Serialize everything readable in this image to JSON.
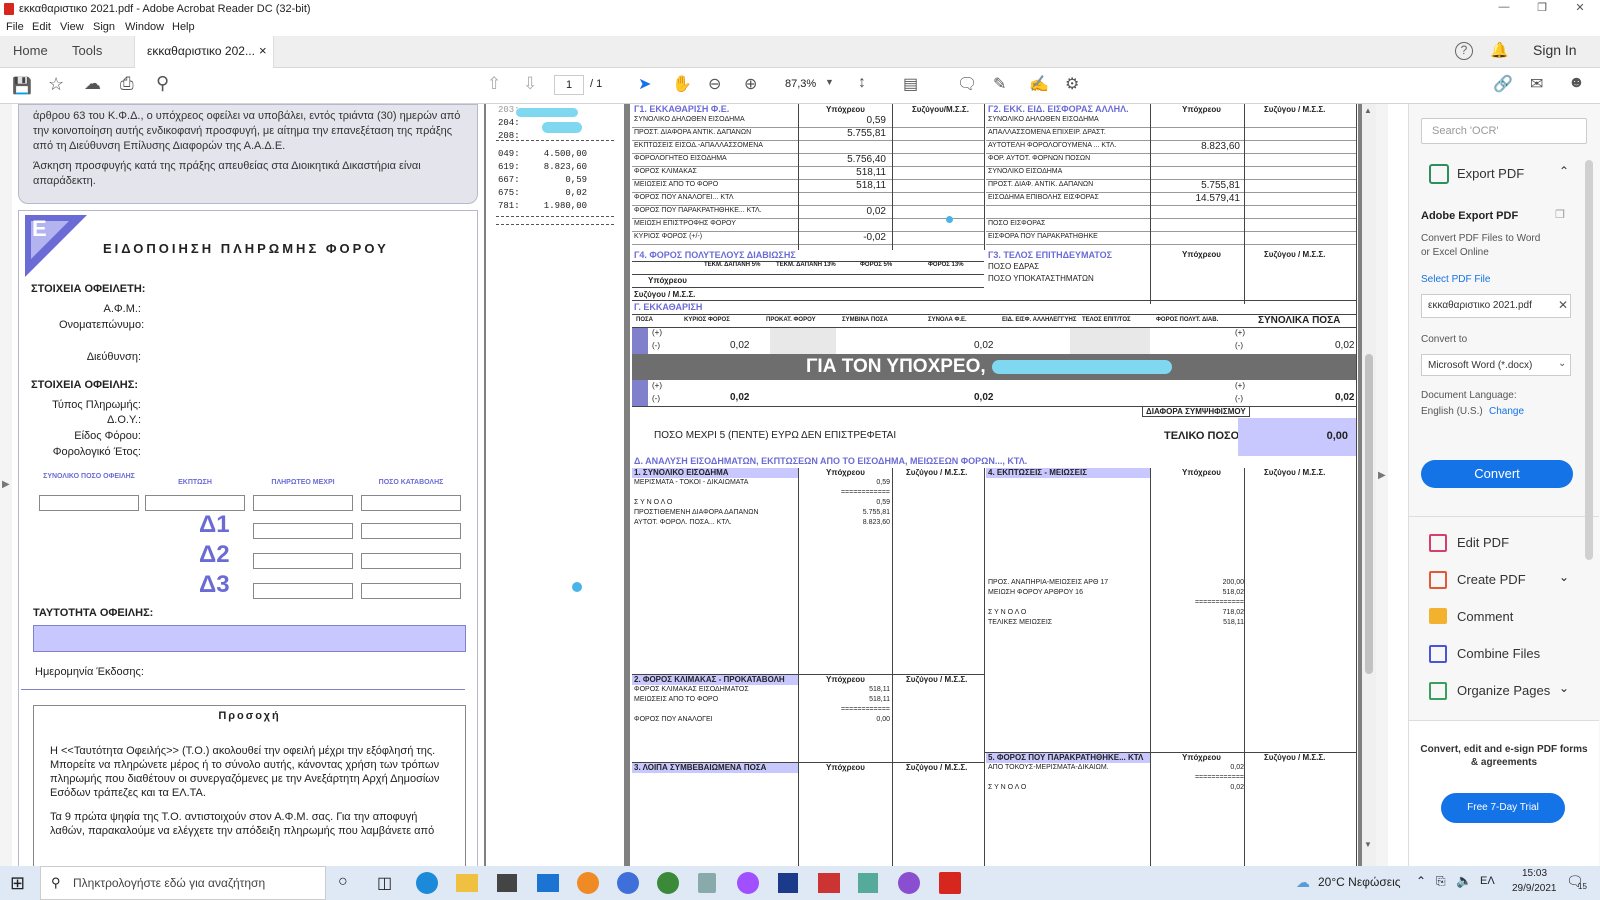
{
  "window": {
    "title": "εκκαθαριστικο 2021.pdf - Adobe Acrobat Reader DC (32-bit)"
  },
  "menu": [
    "File",
    "Edit",
    "View",
    "Sign",
    "Window",
    "Help"
  ],
  "tabs": {
    "home": "Home",
    "tools": "Tools",
    "doc": "εκκαθαριστικο 202...",
    "close": "×",
    "signin": "Sign In"
  },
  "toolbar": {
    "page_current": "1",
    "page_total": "/ 1",
    "zoom": "87,3%"
  },
  "left_page": {
    "appeal_text": "άρθρου 63 του Κ.Φ.Δ., ο υπόχρεος οφείλει να υποβάλει, εντός τριάντα (30) ημερών από την κοινοποίηση αυτής ενδικοφανή προσφυγή, με αίτημα την επανεξέταση της πράξης από τη Διεύθυνση Επίλυσης Διαφορών της Α.Α.Δ.Ε.",
    "appeal_text2": "Άσκηση προσφυγής κατά της πράξης απευθείας στα Διοικητικά Δικαστήρια είναι απαράδεκτη.",
    "badge": "E",
    "title": "ΕΙΔΟΠΟΙΗΣΗ ΠΛΗΡΩΜΗΣ ΦΟΡΟΥ",
    "debtor_header": "ΣΤΟΙΧΕΙΑ ΟΦΕΙΛΕΤΗ:",
    "afm": "Α.Φ.Μ.:",
    "name": "Ονοματεπώνυμο:",
    "address": "Διεύθυνση:",
    "debt_header": "ΣΤΟΙΧΕΙΑ ΟΦΕΙΛΗΣ:",
    "pay_type": "Τύπος Πληρωμής:",
    "doy": "Δ.Ο.Υ.:",
    "tax_kind": "Είδος Φόρου:",
    "tax_year": "Φορολογικό Έτος:",
    "cols": [
      "ΣΥΝΟΛΙΚΟ ΠΟΣΟ ΟΦΕΙΛΗΣ",
      "ΕΚΠΤΩΣΗ",
      "ΠΛΗΡΩΤΕΟ ΜΕΧΡΙ",
      "ΠΟΣΟ ΚΑΤΑΒΟΛΗΣ"
    ],
    "deltas": [
      "Δ1",
      "Δ2",
      "Δ3"
    ],
    "identity": "ΤΑΥΤΟΤΗΤΑ ΟΦΕΙΛΗΣ:",
    "issue_date": "Ημερομηνία Έκδοσης:",
    "attention": "Προσοχή",
    "attention_p1": "Η <<Ταυτότητα Οφειλής>> (Τ.Ο.) ακολουθεί την οφειλή μέχρι την εξόφλησή της. Μπορείτε να πληρώνετε μέρος ή το σύνολο αυτής, κάνοντας χρήση των τρόπων πληρωμής που διαθέτουν οι συνεργαζόμενες με την Ανεξάρτητη Αρχή Δημοσίων Εσόδων τράπεζες και τα ΕΛ.ΤΑ.",
    "attention_p2": "Τα 9 πρώτα ψηφία της Τ.Ο. αντιστοιχούν στον Α.Φ.Μ. σας. Για την αποφυγή λαθών, παρακαλούμε να ελέγχετε την απόδειξη πληρωμής που λαμβάνετε από"
  },
  "middle_page": {
    "codes": [
      {
        "code": "204:",
        "val": ""
      },
      {
        "code": "208:",
        "val": ""
      },
      {
        "code": "049:",
        "val": "4.500,00"
      },
      {
        "code": "619:",
        "val": "8.823,60"
      },
      {
        "code": "667:",
        "val": "0,59"
      },
      {
        "code": "675:",
        "val": "0,02"
      },
      {
        "code": "781:",
        "val": "1.980,00"
      }
    ],
    "top_code": "203: ..."
  },
  "right_page": {
    "g1_title": "Γ1. ΕΚΚΑΘΑΡΙΣΗ Φ.Ε.",
    "g2_title": "Γ2. ΕΚΚ. ΕΙΔ. ΕΙΣΦΟΡΑΣ ΑΛΛΗΛ.",
    "col_ypo": "Υπόχρεου",
    "col_syz": "Συζύγου/Μ.Σ.Σ.",
    "col_syz2": "Συζύγου / Μ.Σ.Σ.",
    "g1_rows": [
      {
        "label": "ΣΥΝΟΛΙΚΟ ΔΗΛΩΘΕΝ ΕΙΣΟΔΗΜΑ",
        "v": "0,59"
      },
      {
        "label": "ΠΡΟΣΤ. ΔΙΑΦΟΡΑ ΑΝΤΙΚ. ΔΑΠΑΝΩΝ",
        "v": "5.755,81"
      },
      {
        "label": "ΕΚΠΤΩΣΕΙΣ ΕΙΣΟΔ.-ΑΠΑΛΛΑΣΣΟΜΕΝΑ",
        "v": ""
      },
      {
        "label": "ΦΟΡΟΛΟΓΗΤΕΟ ΕΙΣΟΔΗΜΑ",
        "v": "5.756,40"
      },
      {
        "label": "ΦΟΡΟΣ ΚΛΙΜΑΚΑΣ",
        "v": "518,11"
      },
      {
        "label": "ΜΕΙΩΣΕΙΣ ΑΠΟ ΤΟ ΦΟΡΟ",
        "v": "518,11"
      },
      {
        "label": "ΦΟΡΟΣ ΠΟΥ ΑΝΑΛΟΓΕΙ... ΚΤΛ",
        "v": ""
      },
      {
        "label": "ΦΟΡΟΣ ΠΟΥ ΠΑΡΑΚΡΑΤΗΘΗΚΕ... ΚΤΛ.",
        "v": "0,02"
      },
      {
        "label": "ΜΕΙΩΣΗ ΕΠΙΣΤΡΟΦΗΣ ΦΟΡΟΥ",
        "v": ""
      },
      {
        "label": "ΚΥΡΙΟΣ ΦΟΡΟΣ (+/-)",
        "v": "-0,02"
      }
    ],
    "g2_rows": [
      {
        "label": "ΣΥΝΟΛΙΚΟ ΔΗΛΩΘΕΝ ΕΙΣΟΔΗΜΑ",
        "v": ""
      },
      {
        "label": "ΑΠΑΛΛΑΣΣΟΜΕΝΑ ΕΠΙΧΕΙΡ. ΔΡΑΣΤ.",
        "v": ""
      },
      {
        "label": "ΑΥΤΟΤΕΛΗ ΦΟΡΟΛΟΓΟΥΜΕΝΑ ... ΚΤΛ.",
        "v": "8.823,60"
      },
      {
        "label": "ΦΟΡ. ΑΥΤΟΤ. ΦΟΡΝΩΝ ΠΟΣΩΝ",
        "v": ""
      },
      {
        "label": "ΣΥΝΟΛΙΚΟ ΕΙΣΟΔΗΜΑ",
        "v": ""
      },
      {
        "label": "ΠΡΟΣΤ. ΔΙΑΦ. ΑΝΤΙΚ. ΔΑΠΑΝΩΝ",
        "v": "5.755,81"
      },
      {
        "label": "ΕΙΣΟΔΗΜΑ ΕΠΙΒΟΛΗΣ ΕΙΣΦΟΡΑΣ",
        "v": "14.579,41"
      },
      {
        "label": "",
        "v": ""
      },
      {
        "label": "ΠΟΣΟ ΕΙΣΦΟΡΑΣ",
        "v": ""
      },
      {
        "label": "ΕΙΣΦΟΡΑ ΠΟΥ ΠΑΡΑΚΡΑΤΗΘΗΚΕ",
        "v": ""
      }
    ],
    "g4_title": "Γ4. ΦΟΡΟΣ ΠΟΛΥΤΕΛΟΥΣ ΔΙΑΒΙΩΣΗΣ",
    "g4_cols": [
      "ΤΕΚΜ. ΔΑΠΑΝΗ 5%",
      "ΤΕΚΜ. ΔΑΠΑΝΗ 13%",
      "ΦΟΡΟΣ 5%",
      "ΦΟΡΟΣ 13%"
    ],
    "g3_title": "Γ3. ΤΕΛΟΣ ΕΠΙΤΗΔΕΥΜΑΤΟΣ",
    "g3_rows": [
      "ΠΟΣΟ ΕΔΡΑΣ",
      "ΠΟΣΟ ΥΠΟΚΑΤΑΣΤΗΜΑΤΩΝ"
    ],
    "g4_rows": [
      "Υπόχρεου",
      "Συζύγου / Μ.Σ.Σ."
    ],
    "g_title": "Γ. ΕΚΚΑΘΑΡΙΣΗ",
    "g_cols": [
      "ΠΟΣΑ",
      "ΚΥΡΙΟΣ ΦΟΡΟΣ",
      "ΠΡΟΚΑΤ. ΦΟΡΟΥ",
      "ΣΥΜΒΙΝΑ ΠΟΣΑ",
      "ΣΥΝΟΛΑ Φ.Ε.",
      "ΕΙΔ. ΕΙΣΦ. ΑΛΛΗΛΕΓΓΥΗΣ",
      "ΤΕΛΟΣ ΕΠΙΤ/ΤΟΣ",
      "ΦΟΡΟΣ ΠΟΛΥΤ. ΔΙΑΒ.",
      "ΣΥΝΟΛΙΚΑ ΠΟΣΑ"
    ],
    "g_side1": "ΥΠΟΧΡΕΟΥ",
    "g_side2": "ΣΥΝΟΛΑ",
    "plus": "(+)",
    "minus": "(-)",
    "g_val1": "0,02",
    "g_val2": "0,02",
    "g_val3": "0,02",
    "banner": "ΓΙΑ ΤΟΝ ΥΠΟΧΡΕΟ,",
    "diff_label": "ΔΙΑΦΟΡΑ ΣΥΜΨΗΦΙΣΜΟΥ",
    "five_euro": "ΠΟΣΟ ΜΕΧΡΙ 5 (ΠΕΝΤΕ) ΕΥΡΩ ΔΕΝ ΕΠΙΣΤΡΕΦΕΤΑΙ",
    "final_label": "ΤΕΛΙΚΟ ΠΟΣΟ",
    "final_value": "0,00",
    "d_title": "Δ. ΑΝΑΛΥΣΗ ΕΙΣΟΔΗΜΑΤΩΝ, ΕΚΠΤΩΣΕΩΝ ΑΠΟ ΤΟ ΕΙΣΟΔΗΜΑ, ΜΕΙΩΣΕΩΝ ΦΟΡΩΝ..., ΚΤΛ.",
    "d1_title": "1. ΣΥΝΟΛΙΚΟ ΕΙΣΟΔΗΜΑ",
    "d1_rows": [
      {
        "label": "ΜΕΡΙΣΜΑΤΑ - ΤΟΚΟΙ - ΔΙΚΑΙΩΜΑΤΑ",
        "v": "0,59"
      },
      {
        "label": "",
        "v": "============"
      },
      {
        "label": "Σ Υ Ν Ο Λ Ο",
        "v": "0,59"
      },
      {
        "label": "ΠΡΟΣΤΙΘΕΜΕΝΗ ΔΙΑΦΟΡΑ ΔΑΠΑΝΩΝ",
        "v": "5.755,81"
      },
      {
        "label": "ΑΥΤΟΤ. ΦΟΡΟΛ. ΠΟΣΑ... ΚΤΛ.",
        "v": "8.823,60"
      }
    ],
    "d4_title": "4. ΕΚΠΤΩΣΕΙΣ - ΜΕΙΩΣΕΙΣ",
    "d4_rows": [
      {
        "label": "ΠΡΟΣ. ΑΝΑΠΗΡΙΑ-ΜΕΙΩΣΕΙΣ ΑΡΘ 17",
        "v": "200,00"
      },
      {
        "label": "ΜΕΙΩΣΗ ΦΟΡΟΥ ΑΡΘΡΟΥ 16",
        "v": "518,02"
      },
      {
        "label": "",
        "v": "============"
      },
      {
        "label": "Σ Υ Ν Ο Λ Ο",
        "v": "718,02"
      },
      {
        "label": "ΤΕΛΙΚΕΣ ΜΕΙΩΣΕΙΣ",
        "v": "518,11"
      }
    ],
    "d2_title": "2. ΦΟΡΟΣ ΚΛΙΜΑΚΑΣ - ΠΡΟΚΑΤΑΒΟΛΗ",
    "d2_rows": [
      {
        "label": "ΦΟΡΟΣ ΚΛΙΜΑΚΑΣ ΕΙΣΟΔΗΜΑΤΟΣ",
        "v": "518,11"
      },
      {
        "label": "ΜΕΙΩΣΕΙΣ ΑΠΟ ΤΟ ΦΟΡΟ",
        "v": "518,11"
      },
      {
        "label": "",
        "v": "============"
      },
      {
        "label": "ΦΟΡΟΣ ΠΟΥ ΑΝΑΛΟΓΕΙ",
        "v": "0,00"
      }
    ],
    "d3_title": "3. ΛΟΙΠΑ ΣΥΜΒΕΒΑΙΩΜΕΝΑ ΠΟΣΑ",
    "d5_title": "5. ΦΟΡΟΣ ΠΟΥ ΠΑΡΑΚΡΑΤΗΘΗΚΕ... ΚΤΛ",
    "d5_rows": [
      {
        "label": "ΑΠΟ ΤΟΚΟΥΣ-ΜΕΡΙΣΜΑΤΑ-ΔΙΚΑΙΩΜ.",
        "v": "0,02"
      },
      {
        "label": "",
        "v": "============"
      },
      {
        "label": "Σ Υ Ν Ο Λ Ο",
        "v": "0,02"
      }
    ]
  },
  "right_panel": {
    "search_placeholder": "Search 'OCR'",
    "export_pdf": "Export PDF",
    "adobe_export": "Adobe Export PDF",
    "convert_desc": "Convert PDF Files to Word or Excel Online",
    "select_file": "Select PDF File",
    "file_name": "εκκαθαριστικο 2021.pdf",
    "convert_to": "Convert to",
    "format": "Microsoft Word (*.docx)",
    "doc_lang": "Document Language:",
    "lang": "English (U.S.)",
    "change": "Change",
    "convert_btn": "Convert",
    "tools": [
      "Edit PDF",
      "Create PDF",
      "Comment",
      "Combine Files",
      "Organize Pages"
    ],
    "promo": "Convert, edit and e-sign PDF forms & agreements",
    "trial": "Free 7-Day Trial"
  },
  "taskbar": {
    "search": "Πληκτρολογήστε εδώ για αναζήτηση",
    "weather": "20°C  Νεφώσεις",
    "lang": "ΕΛ",
    "time": "15:03",
    "date": "29/9/2021",
    "notif": "15"
  },
  "colors": {
    "accent": "#1473e6",
    "lavender": "#c8c8ff",
    "header_blue": "#6b6bd6",
    "banner_gray": "#6e6e6e"
  }
}
